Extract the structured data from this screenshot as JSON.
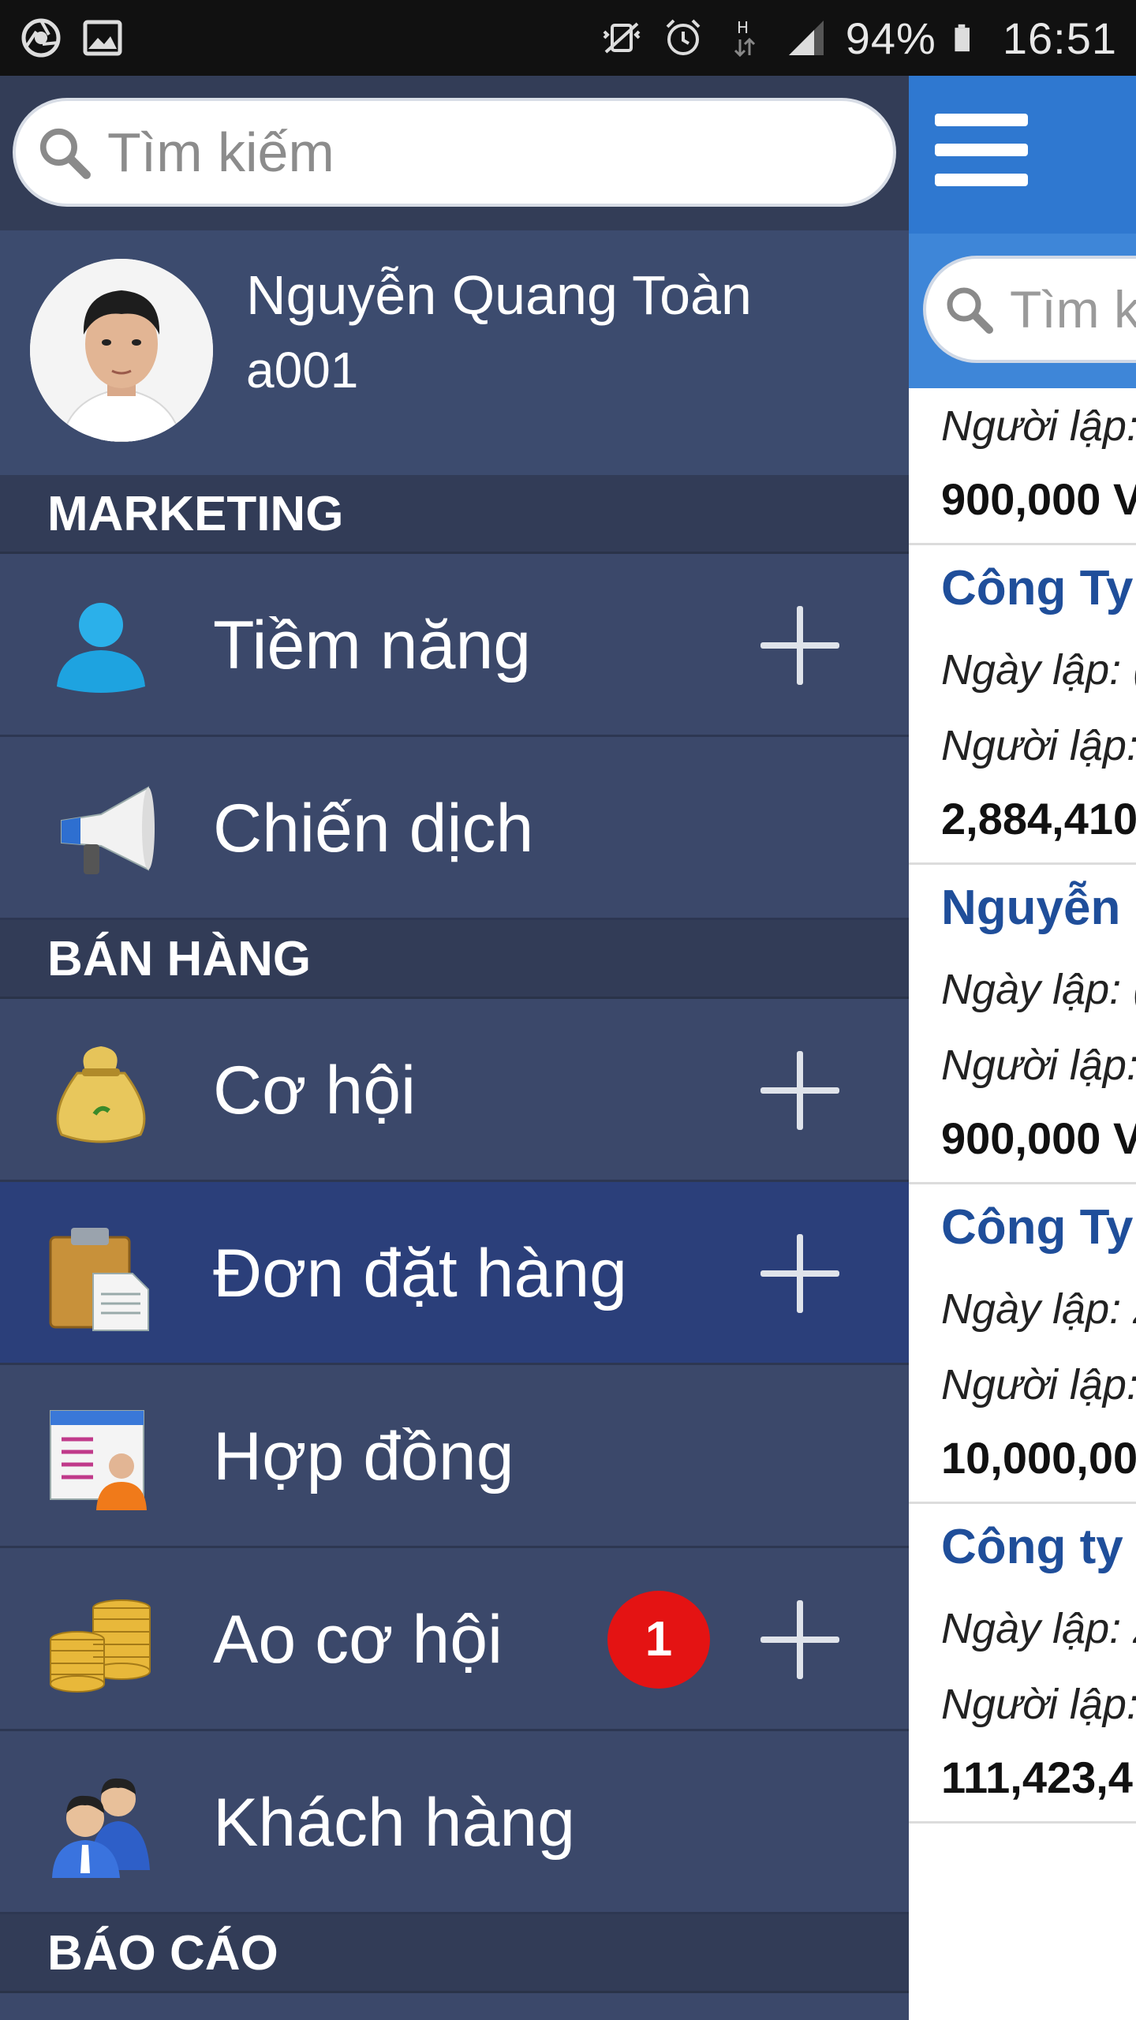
{
  "status_bar": {
    "battery": "94%",
    "time": "16:51",
    "network_type": "H",
    "icons": [
      "chrome-icon",
      "gallery-icon",
      "mute-icon",
      "alarm-icon",
      "data-arrows-icon",
      "signal-icon",
      "battery-icon"
    ]
  },
  "drawer": {
    "search": {
      "placeholder": "Tìm kiếm"
    },
    "profile": {
      "name": "Nguyễn Quang Toàn",
      "user_id": "a001"
    },
    "sections": [
      {
        "title": "MARKETING",
        "items": [
          {
            "label": "Tiềm năng",
            "icon": "person-icon",
            "has_add": true
          },
          {
            "label": "Chiến dịch",
            "icon": "megaphone-icon",
            "has_add": false
          }
        ]
      },
      {
        "title": "BÁN HÀNG",
        "items": [
          {
            "label": "Cơ hội",
            "icon": "money-bag-icon",
            "has_add": true
          },
          {
            "label": "Đơn đặt hàng",
            "icon": "clipboard-icon",
            "has_add": true,
            "active": true
          },
          {
            "label": "Hợp đồng",
            "icon": "contract-icon",
            "has_add": false
          },
          {
            "label": "Ao cơ hội",
            "icon": "coins-icon",
            "has_add": true,
            "badge": "1"
          },
          {
            "label": "Khách hàng",
            "icon": "customers-icon",
            "has_add": false
          }
        ]
      },
      {
        "title": "BÁO CÁO",
        "items": []
      }
    ]
  },
  "content": {
    "search": {
      "placeholder": "Tìm k"
    },
    "cards": [
      {
        "lines": [
          "Người lập:"
        ],
        "amount": "900,000 V"
      },
      {
        "title": "Công Ty",
        "lines": [
          "Ngày lập: (",
          "Người lập:"
        ],
        "amount": "2,884,410"
      },
      {
        "title": "Nguyễn",
        "lines": [
          "Ngày lập: (",
          "Người lập:"
        ],
        "amount": "900,000 V"
      },
      {
        "title": "Công Ty",
        "lines": [
          "Ngày lập: 2",
          "Người lập:"
        ],
        "amount": "10,000,00"
      },
      {
        "title": "Công ty",
        "lines": [
          "Ngày lập: 2",
          "Người lập:"
        ],
        "amount": "111,423,4"
      }
    ]
  },
  "colors": {
    "drawer_bg": "#3b486a",
    "section_bg": "#323c57",
    "active_item_bg": "#2b3f7a",
    "header_blue": "#2f78d0",
    "title_blue": "#1f4e9a",
    "badge_red": "#e41313"
  }
}
